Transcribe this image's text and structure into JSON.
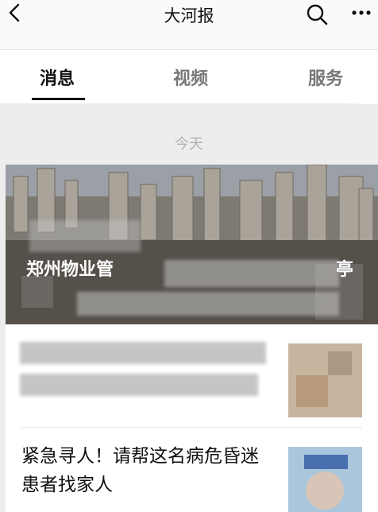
{
  "topbar": {
    "title": "大河报",
    "back_icon": "chevron-left-icon",
    "search_icon": "search-icon",
    "more_icon": "more-horizontal-icon"
  },
  "tabs": [
    {
      "label": "消息",
      "active": true
    },
    {
      "label": "视频",
      "active": false
    },
    {
      "label": "服务",
      "active": false
    }
  ],
  "date_separator": "今天",
  "feed": {
    "hero_title_prefix": "郑州物业管",
    "hero_title_suffix": "亭",
    "items": [
      {
        "title": "紧急寻人！请帮这名病危昏迷患者找家人"
      }
    ]
  },
  "colors": {
    "background": "#ededed",
    "active_tab": "#111111",
    "inactive_tab": "#777777"
  }
}
